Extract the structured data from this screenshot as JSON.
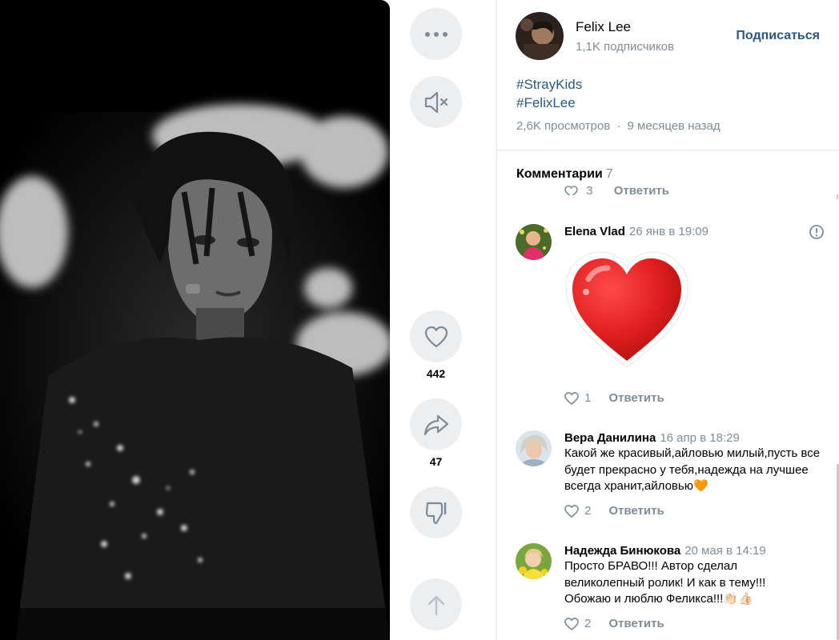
{
  "video": {
    "description_icon": "video-player-frame"
  },
  "rail": {
    "more_icon": "more-dots-icon",
    "mute_icon": "muted-speaker-icon",
    "like_icon": "heart-icon",
    "like_count": "442",
    "share_icon": "share-arrow-icon",
    "share_count": "47",
    "dislike_icon": "thumbs-down-icon",
    "up_icon": "arrow-up-icon"
  },
  "author": {
    "name": "Felix Lee",
    "subscribers": "1,1K подписчиков",
    "subscribe_label": "Подписаться"
  },
  "post": {
    "tags": [
      "#StrayKids",
      "#FelixLee"
    ],
    "views": "2,6K просмотров",
    "separator": "·",
    "posted": "9 месяцев назад"
  },
  "comments": {
    "title": "Комментарии",
    "count": "7",
    "clipped_row": {
      "likes": "3",
      "reply_label": "Ответить"
    },
    "items": [
      {
        "name": "Elena Vlad",
        "date": "26 янв в 19:09",
        "text": "",
        "sticker": "red-heart-sticker",
        "likes": "1",
        "reply_label": "Ответить"
      },
      {
        "name": "Вера Данилина",
        "date": "16 апр в 18:29",
        "text": "Какой же красивый,айловью милый,пусть все будет прекрасно у тебя,надежда на лучшее всегда хранит,айловью🧡",
        "likes": "2",
        "reply_label": "Ответить"
      },
      {
        "name": "Надежда Бинюкова",
        "date": "20 мая в 14:19",
        "text": "Просто БРАВО!!! Автор сделал великолепный ролик! И как в тему!!! Обожаю и люблю Феликса!!!👏🏻👍🏻",
        "likes": "2",
        "reply_label": "Ответить"
      }
    ]
  },
  "colors": {
    "link": "#2a5885",
    "muted": "#818c99",
    "button_bg": "#edeef0",
    "divider": "#e7e8ec",
    "heart": "#e02a2a"
  }
}
